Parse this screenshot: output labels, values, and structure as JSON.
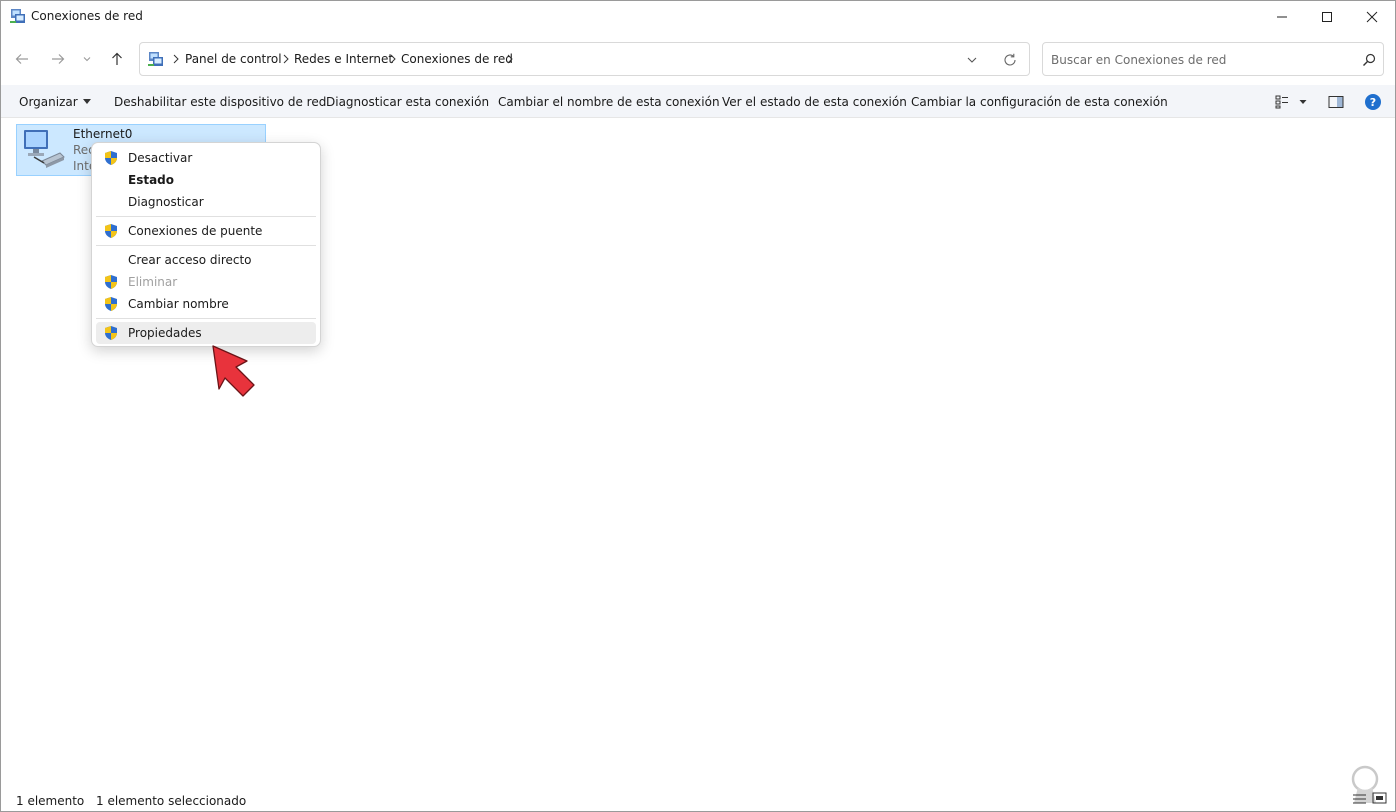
{
  "window": {
    "title": "Conexiones de red",
    "icons": {
      "app": "network-connections-icon",
      "minimize": "minimize-icon",
      "maximize": "maximize-icon",
      "close": "close-icon"
    }
  },
  "nav": {
    "icons": [
      "back-arrow-icon",
      "forward-arrow-icon",
      "recent-locations-chevron-icon",
      "up-arrow-icon"
    ]
  },
  "address": {
    "breadcrumb": [
      "Panel de control",
      "Redes e Internet",
      "Conexiones de red"
    ],
    "icons": {
      "location": "control-panel-icon",
      "dropdown": "chevron-down-icon",
      "refresh": "refresh-icon"
    }
  },
  "search": {
    "placeholder": "Buscar en Conexiones de red",
    "value": ""
  },
  "commandbar": {
    "organize": "Organizar",
    "commands": [
      "Deshabilitar este dispositivo de red",
      "Diagnosticar esta conexión",
      "Cambiar el nombre de esta conexión",
      "Ver el estado de esta conexión",
      "Cambiar la configuración de esta conexión"
    ],
    "icons": {
      "view": "change-view-icon",
      "preview": "preview-pane-icon",
      "help": "help-icon"
    },
    "help_glyph": "?"
  },
  "content": {
    "item": {
      "name": "Ethernet0",
      "line2": "Rec",
      "line3": "Inte",
      "icon": "network-adapter-icon"
    }
  },
  "context_menu": {
    "items": [
      {
        "label": "Desactivar",
        "shield": true
      },
      {
        "label": "Estado",
        "bold": true
      },
      {
        "label": "Diagnosticar"
      },
      {
        "label": "Conexiones de puente",
        "shield": true
      },
      {
        "label": "Crear acceso directo"
      },
      {
        "label": "Eliminar",
        "shield": true,
        "disabled": true
      },
      {
        "label": "Cambiar nombre",
        "shield": true
      },
      {
        "label": "Propiedades",
        "shield": true,
        "highlighted": true
      }
    ],
    "pointer": "red-pointer-arrow"
  },
  "statusbar": {
    "count": "1 elemento",
    "selected": "1 elemento seleccionado",
    "icons": [
      "details-view-icon",
      "large-icons-view-icon"
    ]
  },
  "colors": {
    "selection": "#cce8ff",
    "selection_border": "#99d1ff",
    "commandbar_bg": "#f3f5f9",
    "shield_blue": "#2f6fd0",
    "shield_yellow": "#f3c418",
    "arrow_red": "#e8333c"
  }
}
